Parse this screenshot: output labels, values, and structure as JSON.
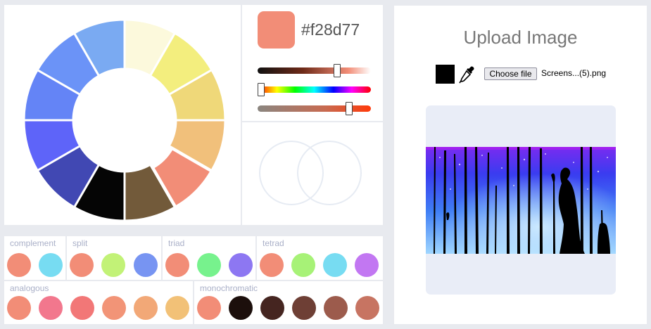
{
  "color_wheel": {
    "segments": [
      {
        "color": "#fcf9dc"
      },
      {
        "color": "#f3ee7e"
      },
      {
        "color": "#efd879"
      },
      {
        "color": "#f1c07b"
      },
      {
        "color": "#f28d77"
      },
      {
        "color": "#725a3a"
      },
      {
        "color": "#050505"
      },
      {
        "color": "#4148b3"
      },
      {
        "color": "#5e64f9"
      },
      {
        "color": "#6484f6"
      },
      {
        "color": "#6b93f7"
      },
      {
        "color": "#7aaaf2"
      }
    ],
    "selected_index": 4
  },
  "picker": {
    "current_color": "#f28d77",
    "hex_text": "#f28d77",
    "sliders": [
      {
        "name": "lightness",
        "value": 0.7
      },
      {
        "name": "hue",
        "value": 0.03
      },
      {
        "name": "saturation",
        "value": 0.81
      }
    ]
  },
  "harmonies": {
    "complement": {
      "label": "complement",
      "colors": [
        "#f28d77",
        "#77dcf2"
      ]
    },
    "split": {
      "label": "split",
      "colors": [
        "#f28d77",
        "#c2f277",
        "#7794f2"
      ]
    },
    "triad": {
      "label": "triad",
      "colors": [
        "#f28d77",
        "#77f28d",
        "#8d77f2"
      ]
    },
    "tetrad": {
      "label": "tetrad",
      "colors": [
        "#f28d77",
        "#a7f277",
        "#77dcf2",
        "#c277f2"
      ]
    },
    "analogous": {
      "label": "analogous",
      "colors": [
        "#f28d77",
        "#f2778d",
        "#f27777",
        "#f29477",
        "#f2a877",
        "#f2c177"
      ]
    },
    "monochromatic": {
      "label": "monochromatic",
      "colors": [
        "#f28d77",
        "#1c0f0c",
        "#452520",
        "#6e3f35",
        "#9c5b4c",
        "#c77462"
      ]
    }
  },
  "upload": {
    "title": "Upload Image",
    "picked_color": "#000000",
    "choose_label": "Choose file",
    "file_name": "Screens...(5).png",
    "icons": {
      "dropper": "eyedropper-icon"
    }
  }
}
